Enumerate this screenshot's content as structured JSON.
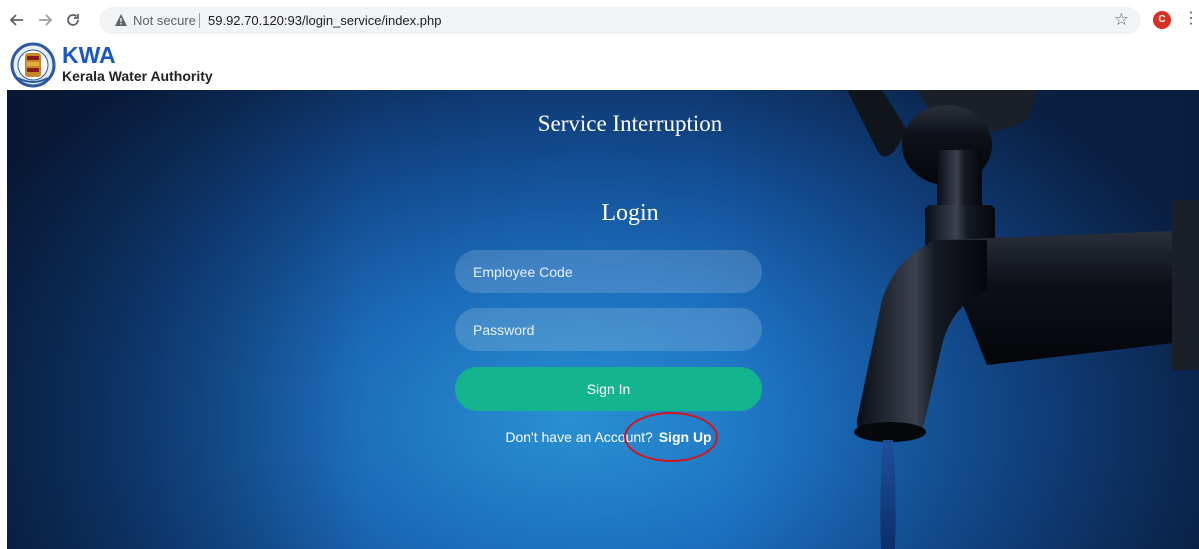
{
  "browser": {
    "security_label": "Not secure",
    "url": "59.92.70.120:93/login_service/index.php",
    "profile_initial": "C",
    "icons": [
      "back-arrow-icon",
      "forward-arrow-icon",
      "reload-icon",
      "warning-icon",
      "star-icon",
      "more-vert-icon"
    ]
  },
  "site": {
    "short_name": "KWA",
    "full_name": "Kerala Water Authority"
  },
  "main": {
    "page_title": "Service Interruption",
    "form_title": "Login",
    "employee_code_placeholder": "Employee Code",
    "password_placeholder": "Password",
    "signin_label": "Sign In",
    "signup_prompt": "Don't have an Account?",
    "signup_label": "Sign Up"
  },
  "colors": {
    "signin_button": "#14b48f",
    "brand_blue": "#1a56c4",
    "highlight_circle": "#d4141c"
  }
}
